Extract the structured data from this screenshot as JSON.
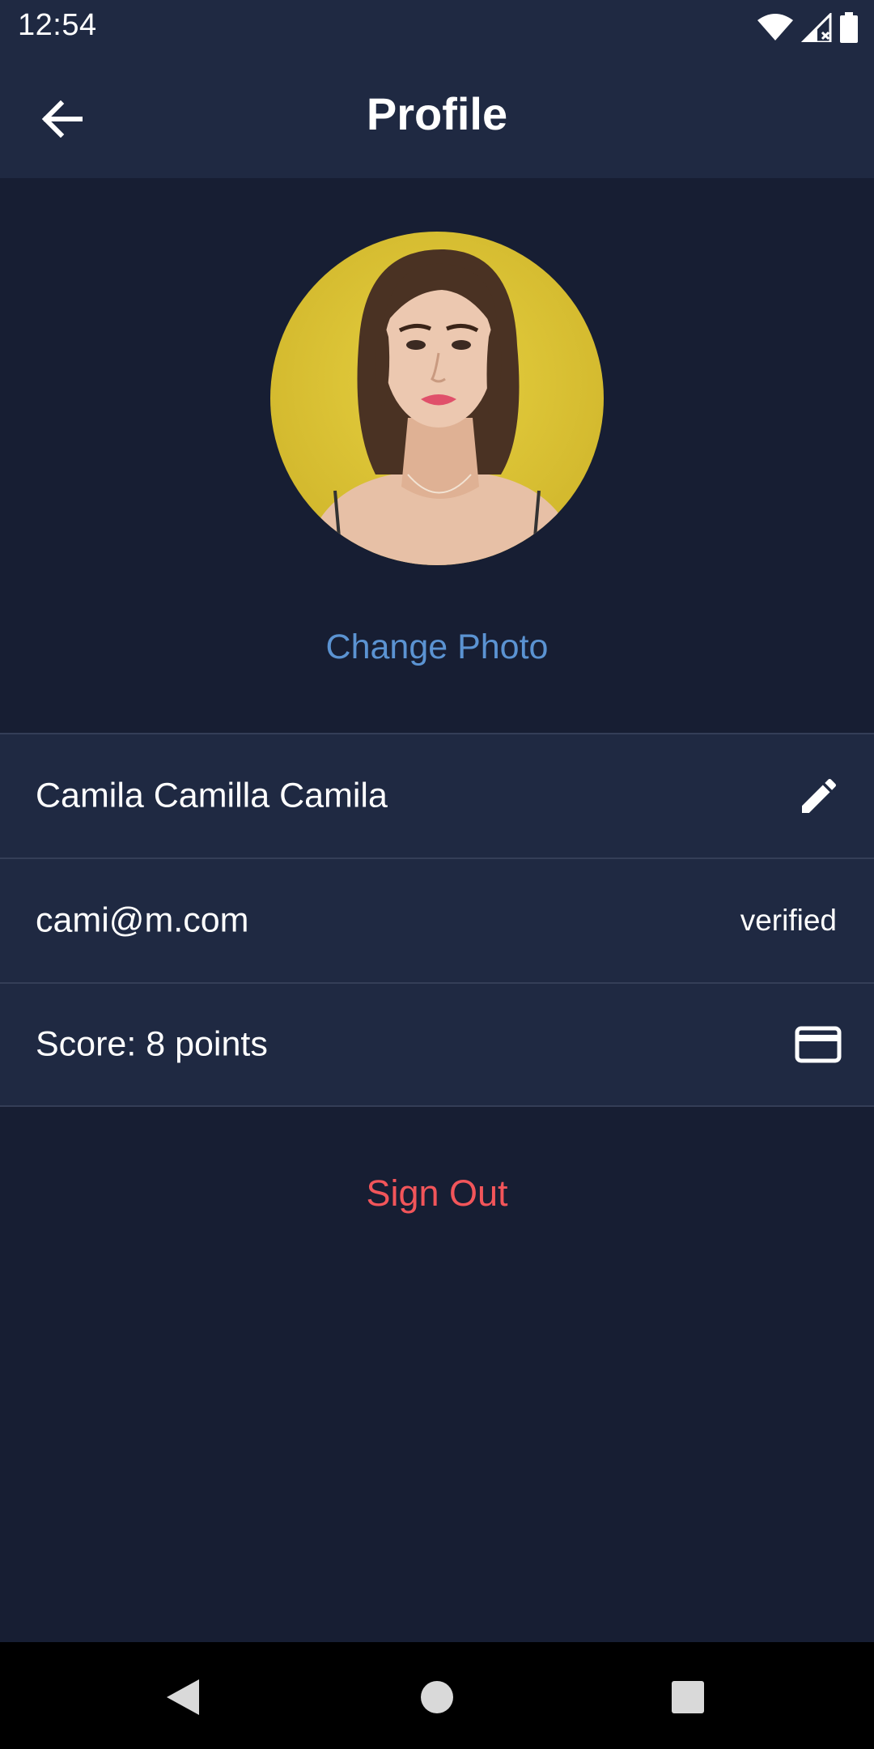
{
  "status_bar": {
    "time": "12:54",
    "icons": [
      "wifi-icon",
      "signal-icon",
      "battery-icon"
    ]
  },
  "app_bar": {
    "title": "Profile",
    "back_icon": "arrow-left-icon"
  },
  "profile": {
    "avatar": "profile-photo",
    "change_photo_label": "Change Photo"
  },
  "rows": {
    "name": {
      "text": "Camila Camilla Camila",
      "icon": "pencil-icon"
    },
    "email": {
      "text": "cami@m.com",
      "status": "verified"
    },
    "score": {
      "text": "Score: 8 points",
      "icon": "credit-card-icon"
    }
  },
  "actions": {
    "sign_out_label": "Sign Out"
  },
  "colors": {
    "background": "#171e33",
    "surface": "#1f2942",
    "divider": "#343e57",
    "link": "#5b93d2",
    "danger": "#f2555a"
  },
  "navigation": {
    "buttons": [
      "back-triangle-icon",
      "home-circle-icon",
      "recents-square-icon"
    ]
  }
}
